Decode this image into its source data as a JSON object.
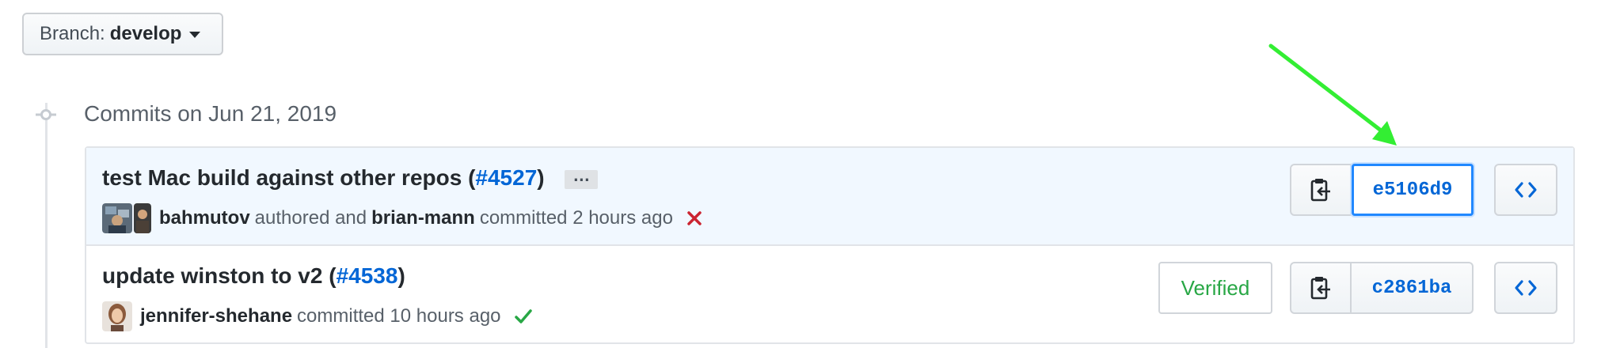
{
  "branch": {
    "label": "Branch:",
    "name": "develop"
  },
  "date_header": "Commits on Jun 21, 2019",
  "commits": [
    {
      "message": "test Mac build against other repos (",
      "pr_link": "#4527",
      "message_end": ")",
      "ellipsis": "…",
      "author": "bahmutov",
      "authored_text": "authored and",
      "committer": "brian-mann",
      "committed_text": "committed 2 hours ago",
      "status": "failure",
      "sha": "e5106d9"
    },
    {
      "message": "update winston to v2 (",
      "pr_link": "#4538",
      "message_end": ")",
      "author": "jennifer-shehane",
      "committed_text": "committed 10 hours ago",
      "status": "success",
      "verified": "Verified",
      "sha": "c2861ba"
    }
  ],
  "colors": {
    "link": "#0366d6",
    "failure": "#cb2431",
    "success": "#28a745",
    "annotation_arrow": "#33ee33"
  }
}
